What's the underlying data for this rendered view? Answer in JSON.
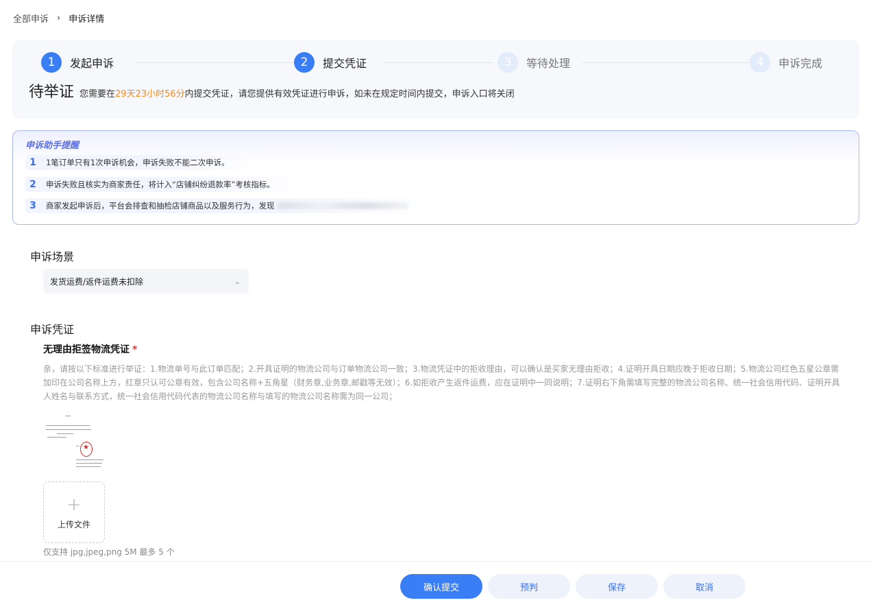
{
  "breadcrumb": {
    "root": "全部申诉",
    "separator": "›",
    "current": "申诉详情"
  },
  "steps": [
    {
      "num": "1",
      "label": "发起申诉",
      "state": "done"
    },
    {
      "num": "2",
      "label": "提交凭证",
      "state": "active"
    },
    {
      "num": "3",
      "label": "等待处理",
      "state": "pending"
    },
    {
      "num": "4",
      "label": "申诉完成",
      "state": "pending"
    }
  ],
  "status": {
    "title": "待举证",
    "desc_prefix": "您需要在",
    "countdown": "29天23小时56分",
    "desc_suffix": "内提交凭证，请您提供有效凭证进行申诉，如未在规定时间内提交，申诉入口将关闭"
  },
  "reminder": {
    "title": "申诉助手提醒",
    "items": [
      {
        "num": "1",
        "text": "1笔订单只有1次申诉机会，申诉失败不能二次申诉。"
      },
      {
        "num": "2",
        "text": "申诉失败且核实为商家责任，将计入“店铺纠纷退款率”考核指标。"
      },
      {
        "num": "3",
        "text": "商家发起申诉后，平台会排查和抽检店铺商品以及服务行为，发现"
      }
    ]
  },
  "scene": {
    "title": "申诉场景",
    "selected": "发货运费/返件运费未扣除"
  },
  "evidence": {
    "title": "申诉凭证",
    "item_title": "无理由拒签物流凭证",
    "required_mark": "*",
    "guide": "亲，请按以下标准进行举证：1.物流单号与此订单匹配；2.开具证明的物流公司与订单物流公司一致；3.物流凭证中的拒收理由，可以确认是买家无理由拒收；4.证明开具日期应晚于拒收日期；5.物流公司红色五星公章需加印在公司名称上方，红章只认可公章有效，包含公司名称+五角星（财务章,业务章,邮戳等无效）；6.如拒收产生返件运费，应在证明中一同说明；7.证明右下角需填写完整的物流公司名称、统一社会信用代码、证明开具人姓名与联系方式，统一社会信用代码代表的物流公司名称与填写的物流公司名称需为同一公司；",
    "upload_label": "上传文件",
    "upload_hint": "仅支持 jpg,jpeg,png 5M 最多 5 个"
  },
  "footer": {
    "confirm": "确认提交",
    "predict": "预判",
    "save": "保存",
    "cancel": "取消"
  },
  "colors": {
    "primary": "#3a7ef5",
    "countdown": "#f58a1f",
    "required": "#e53935"
  }
}
